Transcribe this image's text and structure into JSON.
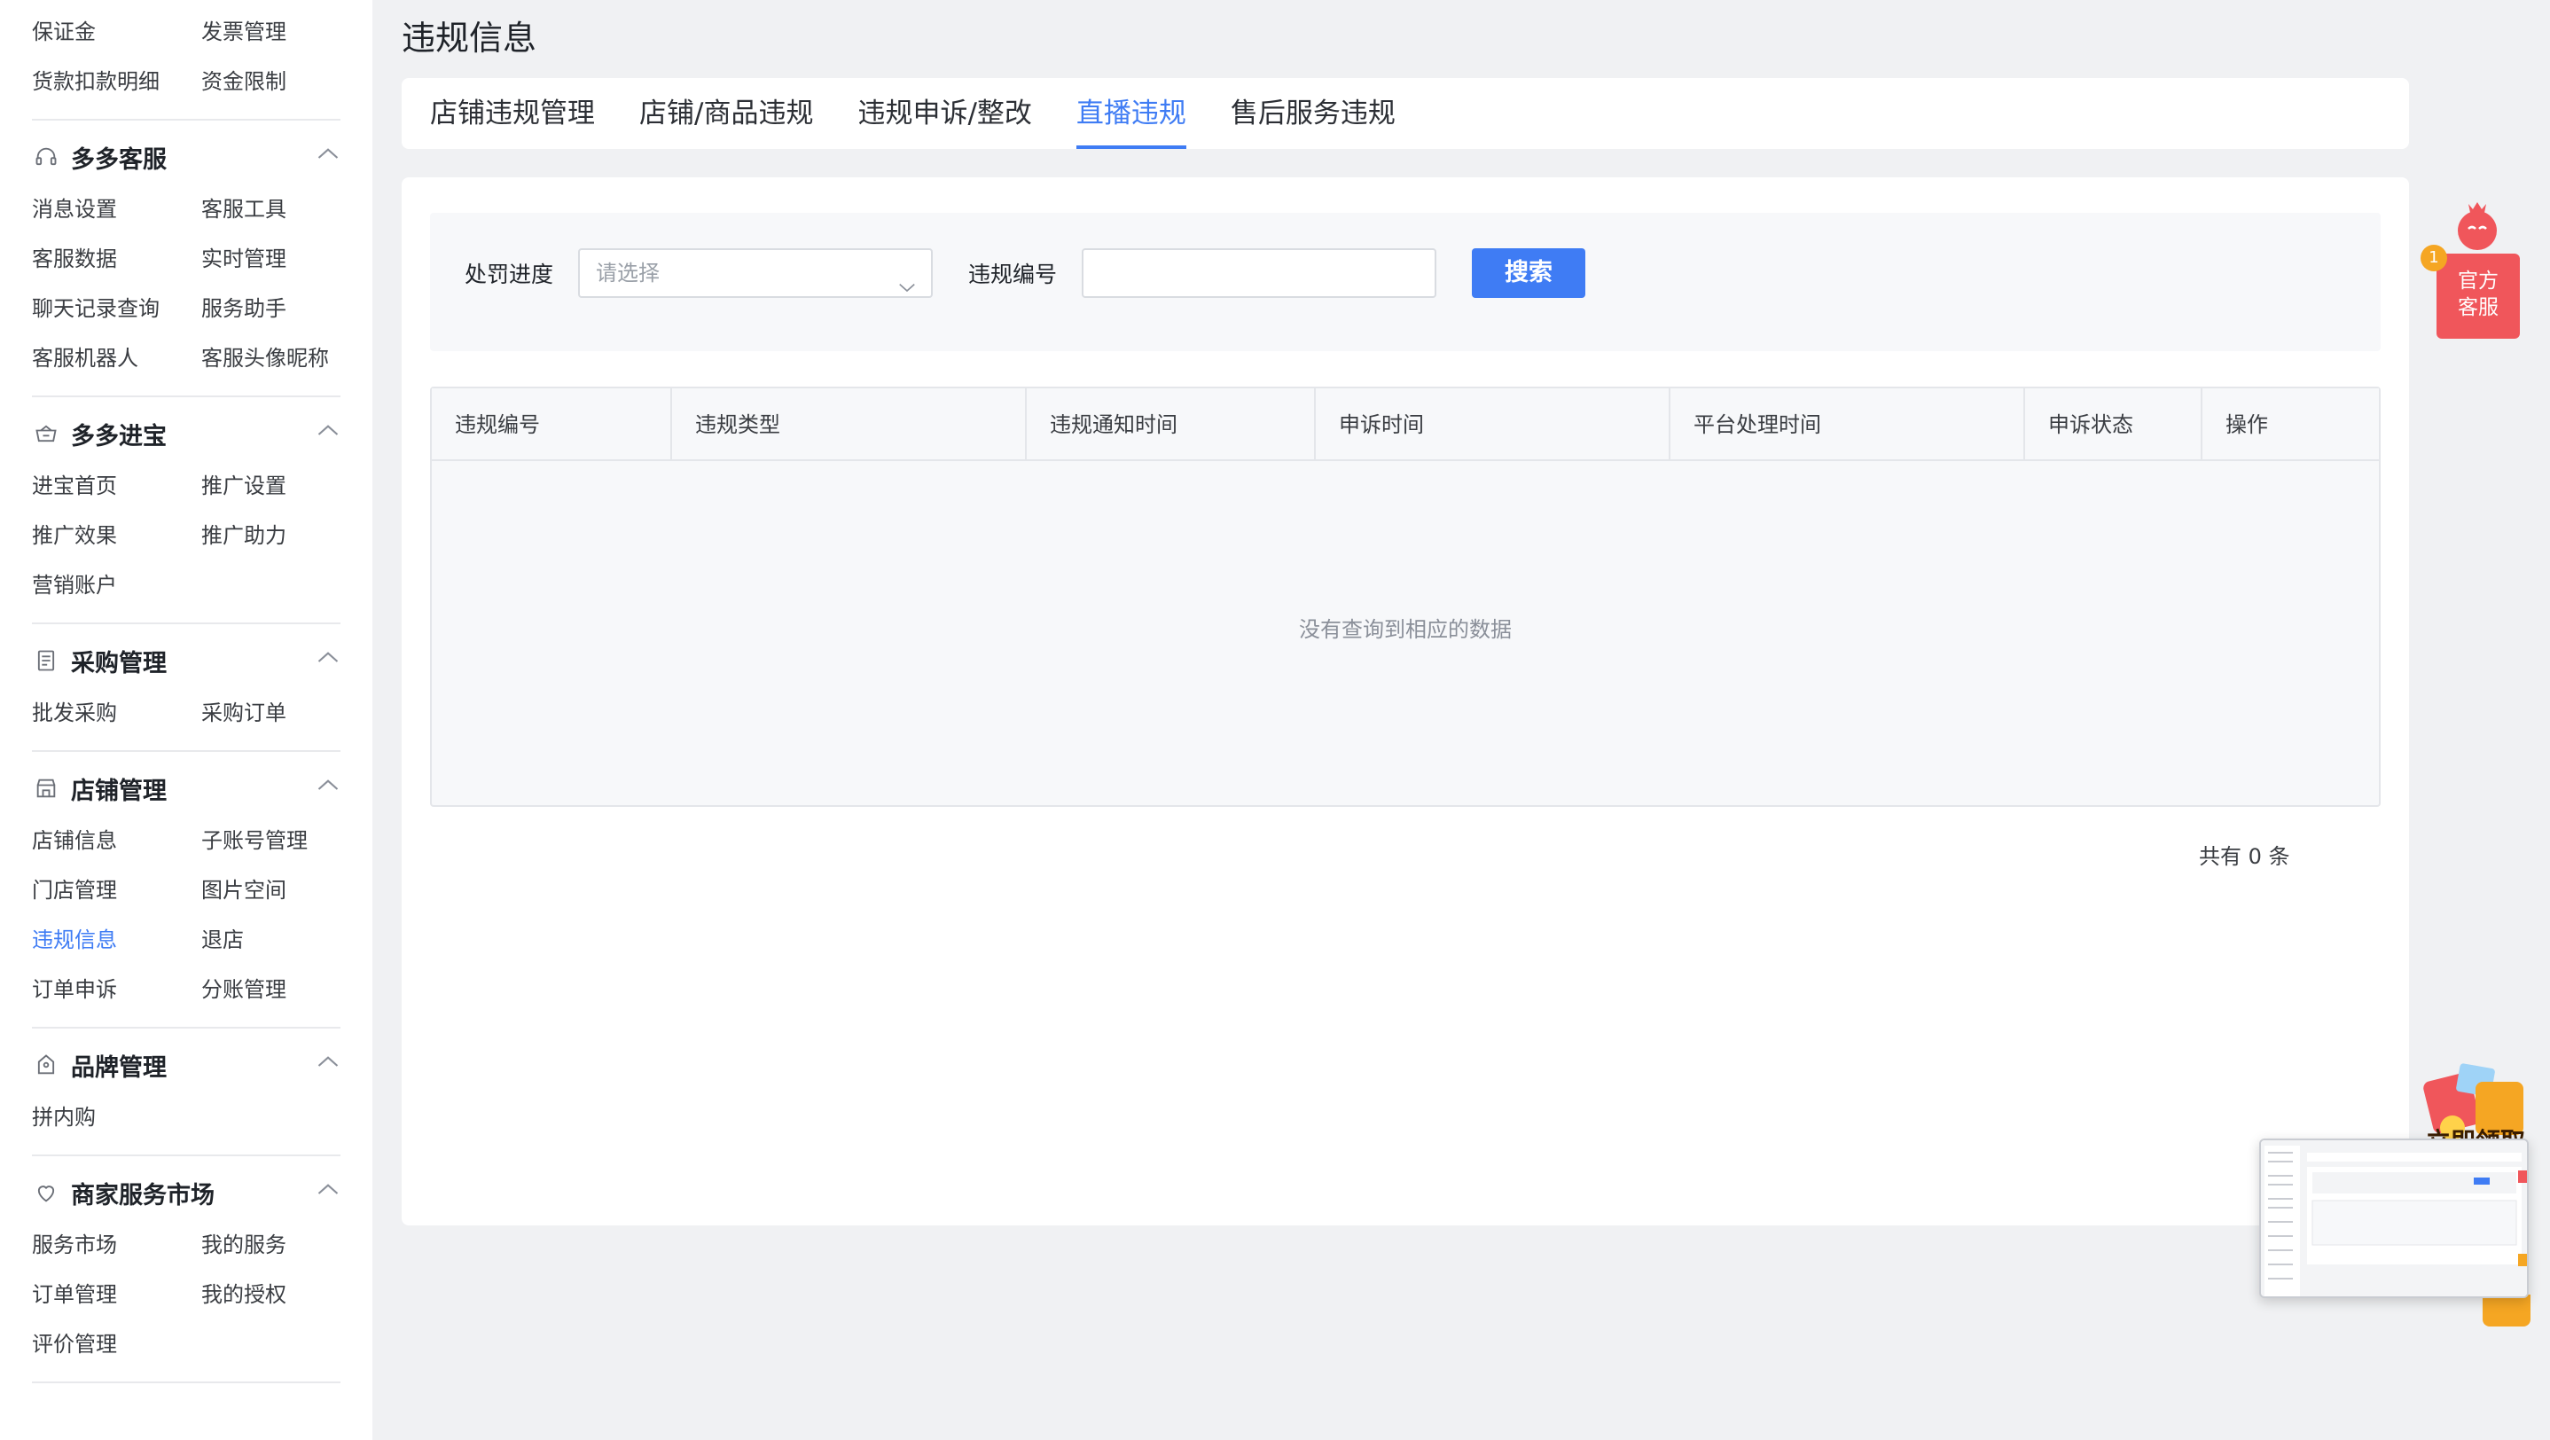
{
  "page": {
    "title": "违规信息"
  },
  "sidebar": {
    "top_items": [
      "保证金",
      "发票管理",
      "货款扣款明细",
      "资金限制"
    ],
    "sections": [
      {
        "title": "多多客服",
        "icon": "headset-icon",
        "items": [
          "消息设置",
          "客服工具",
          "客服数据",
          "实时管理",
          "聊天记录查询",
          "服务助手",
          "客服机器人",
          "客服头像昵称"
        ]
      },
      {
        "title": "多多进宝",
        "icon": "treasure-icon",
        "items": [
          "进宝首页",
          "推广设置",
          "推广效果",
          "推广助力",
          "营销账户"
        ]
      },
      {
        "title": "采购管理",
        "icon": "book-icon",
        "items": [
          "批发采购",
          "采购订单"
        ]
      },
      {
        "title": "店铺管理",
        "icon": "store-icon",
        "items": [
          "店铺信息",
          "子账号管理",
          "门店管理",
          "图片空间",
          "违规信息",
          "退店",
          "订单申诉",
          "分账管理"
        ]
      },
      {
        "title": "品牌管理",
        "icon": "brand-tag-icon",
        "items": [
          "拼内购"
        ]
      },
      {
        "title": "商家服务市场",
        "icon": "heart-icon",
        "items": [
          "服务市场",
          "我的服务",
          "订单管理",
          "我的授权",
          "评价管理"
        ]
      }
    ],
    "active_item": "违规信息"
  },
  "tabs": [
    {
      "label": "店铺违规管理"
    },
    {
      "label": "店铺/商品违规"
    },
    {
      "label": "违规申诉/整改"
    },
    {
      "label": "直播违规",
      "active": true
    },
    {
      "label": "售后服务违规"
    }
  ],
  "filter": {
    "progress_label": "处罚进度",
    "progress_placeholder": "请选择",
    "number_label": "违规编号",
    "number_value": "",
    "search_label": "搜索"
  },
  "table": {
    "columns": [
      "违规编号",
      "违规类型",
      "违规通知时间",
      "申诉时间",
      "平台处理时间",
      "申诉状态",
      "操作"
    ],
    "rows": [],
    "empty_text": "没有查询到相应的数据"
  },
  "pagination": {
    "total_text": "共有 0 条"
  },
  "floating": {
    "service_line1": "官方",
    "service_line2": "客服",
    "badge": "1",
    "promo_text": "立即领取"
  },
  "colors": {
    "accent": "#3f7cf4",
    "service": "#f0565b",
    "badge": "#f5a623"
  }
}
